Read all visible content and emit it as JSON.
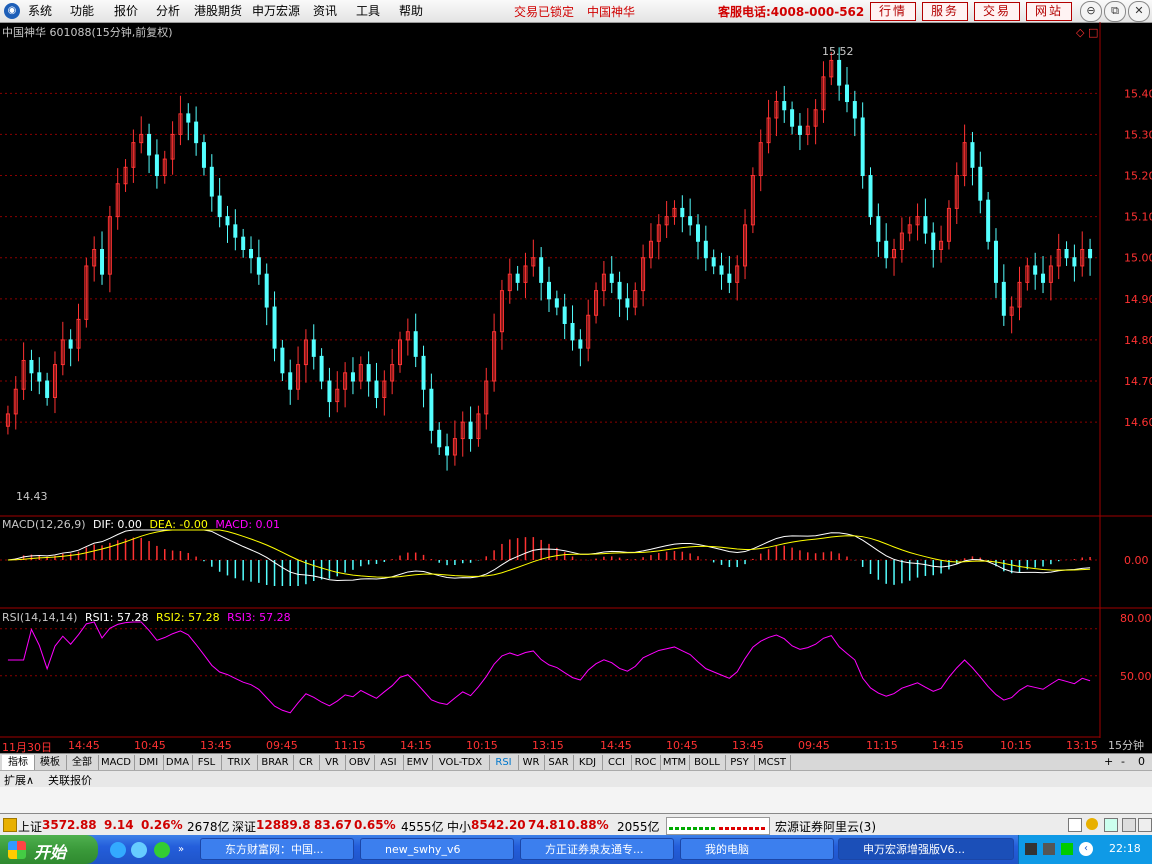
{
  "menubar": {
    "items": [
      "系统",
      "功能",
      "报价",
      "分析",
      "港股期货",
      "申万宏源",
      "资讯",
      "工具",
      "帮助"
    ],
    "trade_locked": "交易已锁定",
    "stock_name": "中国神华",
    "hotline": "客服电话:4008-000-562",
    "buttons": [
      "行情",
      "服务",
      "交易",
      "网站"
    ]
  },
  "chart": {
    "header": "中国神华 601088(15分钟,前复权)",
    "high_label": "15.52",
    "low_label": "14.43",
    "price_ticks": [
      "15.40",
      "15.30",
      "15.20",
      "15.10",
      "15.00",
      "14.90",
      "14.80",
      "14.70",
      "14.60"
    ],
    "macd_header": {
      "name": "MACD(12,26,9)",
      "dif": "DIF: 0.00",
      "dea": "DEA: -0.00",
      "macd": "MACD: 0.01"
    },
    "macd_tick": "0.00",
    "rsi_header": {
      "name": "RSI(14,14,14)",
      "rsi1": "RSI1: 57.28",
      "rsi2": "RSI2: 57.28",
      "rsi3": "RSI3: 57.28"
    },
    "rsi_ticks": [
      "80.00",
      "50.00"
    ],
    "time_labels": [
      "11月30日",
      "14:45",
      "10:45",
      "13:45",
      "09:45",
      "11:15",
      "14:15",
      "10:15",
      "13:15",
      "14:45",
      "10:45",
      "13:45",
      "09:45",
      "11:15",
      "14:15",
      "10:15",
      "13:15"
    ],
    "period_label": "15分钟",
    "colors": {
      "up": "#ff3232",
      "down": "#54ffff",
      "dif": "#ffffff",
      "dea": "#ffff00",
      "rsi": "#ff00ff",
      "grid": "#8b0000"
    }
  },
  "chart_data": {
    "type": "candlestick",
    "title": "中国神华 601088(15分钟,前复权)",
    "ylim": [
      14.43,
      15.52
    ],
    "high": 15.52,
    "low": 14.43,
    "close_series": [
      14.62,
      14.68,
      14.75,
      14.72,
      14.7,
      14.66,
      14.74,
      14.8,
      14.78,
      14.85,
      14.98,
      15.02,
      14.96,
      15.1,
      15.18,
      15.22,
      15.28,
      15.3,
      15.25,
      15.2,
      15.24,
      15.3,
      15.35,
      15.33,
      15.28,
      15.22,
      15.15,
      15.1,
      15.08,
      15.05,
      15.02,
      15.0,
      14.96,
      14.88,
      14.78,
      14.72,
      14.68,
      14.74,
      14.8,
      14.76,
      14.7,
      14.65,
      14.68,
      14.72,
      14.7,
      14.74,
      14.7,
      14.66,
      14.7,
      14.74,
      14.8,
      14.82,
      14.76,
      14.68,
      14.58,
      14.54,
      14.52,
      14.56,
      14.6,
      14.56,
      14.62,
      14.7,
      14.82,
      14.92,
      14.96,
      14.94,
      14.98,
      15.0,
      14.94,
      14.9,
      14.88,
      14.84,
      14.8,
      14.78,
      14.86,
      14.92,
      14.96,
      14.94,
      14.9,
      14.88,
      14.92,
      15.0,
      15.04,
      15.08,
      15.1,
      15.12,
      15.1,
      15.08,
      15.04,
      15.0,
      14.98,
      14.96,
      14.94,
      14.98,
      15.08,
      15.2,
      15.28,
      15.34,
      15.38,
      15.36,
      15.32,
      15.3,
      15.32,
      15.36,
      15.44,
      15.48,
      15.42,
      15.38,
      15.34,
      15.2,
      15.1,
      15.04,
      15.0,
      15.02,
      15.06,
      15.08,
      15.1,
      15.06,
      15.02,
      15.04,
      15.12,
      15.2,
      15.28,
      15.22,
      15.14,
      15.04,
      14.94,
      14.86,
      14.88,
      14.94,
      14.98,
      14.96,
      14.94,
      14.98,
      15.02,
      15.0,
      14.98,
      15.02,
      15.0
    ]
  },
  "time_axis_extra": [
    "+",
    "-",
    "0"
  ],
  "indicator_tabs": [
    "指标",
    "模板",
    "全部",
    "MACD",
    "DMI",
    "DMA",
    "FSL",
    "TRIX",
    "BRAR",
    "CR",
    "VR",
    "OBV",
    "ASI",
    "EMV",
    "VOL-TDX",
    "RSI",
    "WR",
    "SAR",
    "KDJ",
    "CCI",
    "ROC",
    "MTM",
    "BOLL",
    "PSY",
    "MCST"
  ],
  "ext_tabs": [
    "扩展∧",
    "关联报价"
  ],
  "quotes": {
    "sh_label": "上证",
    "sh_val": "3572.88",
    "sh_chg": "9.14",
    "sh_pct": "0.26%",
    "sh_amt": "2678亿",
    "sz_label": "深证",
    "sz_val": "12889.8",
    "sz_chg": "83.67",
    "sz_pct": "0.65%",
    "sz_amt": "4555亿",
    "zx_label": "中小",
    "zx_val": "8542.20",
    "zx_chg": "74.81",
    "zx_pct": "0.88%",
    "zx_amt": "2055亿",
    "broker": "宏源证券阿里云(3)"
  },
  "taskbar": {
    "start": "开始",
    "tasks": [
      "东方财富网：中国...",
      "new_swhy_v6",
      "方正证券泉友通专...",
      "我的电脑",
      "申万宏源增强版V6..."
    ],
    "clock": "22:18"
  }
}
